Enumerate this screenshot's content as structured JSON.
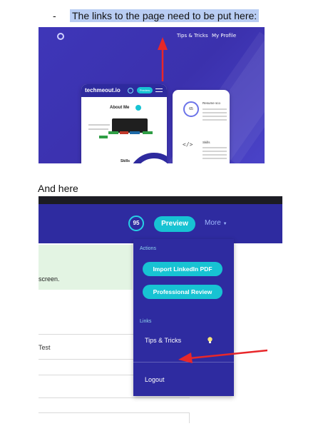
{
  "doc": {
    "bullet_marker": "-",
    "intro_text": "The links to the page need to be put here:",
    "caption": "And here"
  },
  "shot1": {
    "nav_links": [
      "Tips & Tricks",
      "My Profile"
    ],
    "brand": "techmeout.io",
    "mini_preview": "Preview",
    "about_title": "About Me",
    "resume_title": "Resume sco",
    "score": "65",
    "skills_side": "Skills",
    "skills_card": "Skills"
  },
  "shot2": {
    "score": "95",
    "preview_label": "Preview",
    "more_label": "More",
    "body_fragment": "screen.",
    "field_fragment": "Test",
    "dropdown": {
      "actions_header": "Actions",
      "import_label": "Import LinkedIn PDF",
      "review_label": "Professional Review",
      "links_header": "Links",
      "tips_label": "Tips & Tricks",
      "logout_label": "Logout"
    }
  },
  "colors": {
    "highlight": "#b9cdf3",
    "brand_blue": "#2e2ba0",
    "teal": "#17c3d3",
    "arrow_red": "#e8272a",
    "tip_green": "#e3f4e3"
  },
  "icons": [
    "red-arrow-icon",
    "logo-ring-icon",
    "lightbulb-icon",
    "chevron-down-icon",
    "code-icon"
  ]
}
